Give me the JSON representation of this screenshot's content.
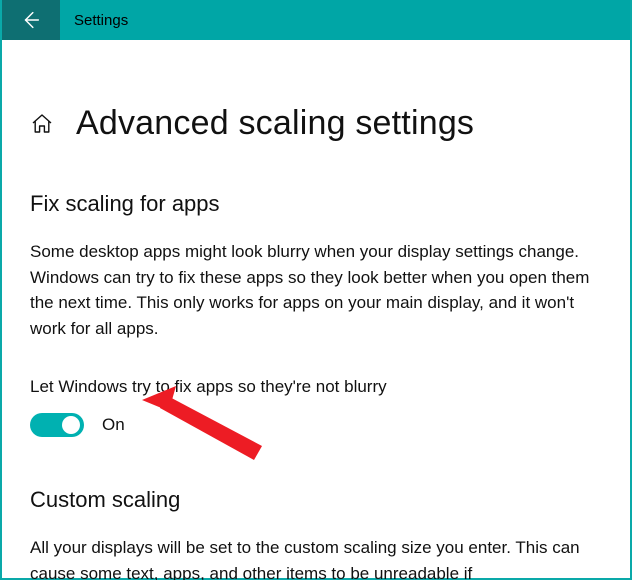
{
  "titlebar": {
    "label": "Settings"
  },
  "page": {
    "title": "Advanced scaling settings"
  },
  "section_fix": {
    "heading": "Fix scaling for apps",
    "description": "Some desktop apps might look blurry when your display settings change. Windows can try to fix these apps so they look better when you open them the next time. This only works for apps on your main display, and it won't work for all apps.",
    "toggle_label": "Let Windows try to fix apps so they're not blurry",
    "toggle_state": "On"
  },
  "section_custom": {
    "heading": "Custom scaling",
    "description": "All your displays will be set to the custom scaling size you enter. This can cause some text, apps, and other items to be unreadable if"
  },
  "colors": {
    "accent": "#00a6a6",
    "arrow": "#ed1c24"
  }
}
